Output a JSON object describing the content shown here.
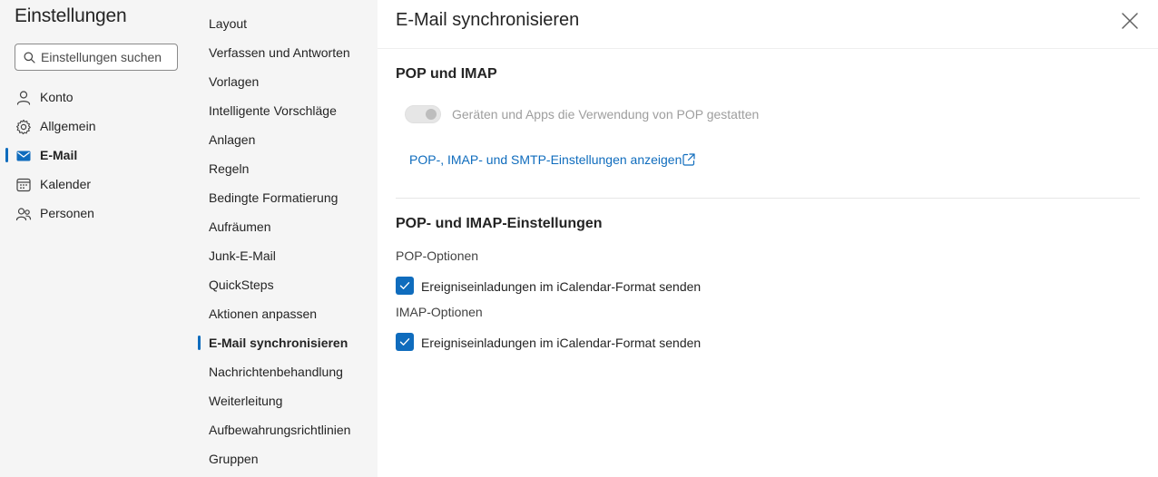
{
  "app": {
    "title": "Einstellungen"
  },
  "search": {
    "placeholder": "Einstellungen suchen",
    "value": ""
  },
  "categories": [
    {
      "label": "Konto",
      "icon": "person-icon"
    },
    {
      "label": "Allgemein",
      "icon": "gear-icon"
    },
    {
      "label": "E-Mail",
      "icon": "mail-icon",
      "active": true
    },
    {
      "label": "Kalender",
      "icon": "calendar-icon"
    },
    {
      "label": "Personen",
      "icon": "people-icon"
    }
  ],
  "submenu": [
    {
      "label": "Layout"
    },
    {
      "label": "Verfassen und Antworten"
    },
    {
      "label": "Vorlagen"
    },
    {
      "label": "Intelligente Vorschläge"
    },
    {
      "label": "Anlagen"
    },
    {
      "label": "Regeln"
    },
    {
      "label": "Bedingte Formatierung"
    },
    {
      "label": "Aufräumen"
    },
    {
      "label": "Junk-E-Mail"
    },
    {
      "label": "QuickSteps"
    },
    {
      "label": "Aktionen anpassen"
    },
    {
      "label": "E-Mail synchronisieren",
      "active": true
    },
    {
      "label": "Nachrichtenbehandlung"
    },
    {
      "label": "Weiterleitung"
    },
    {
      "label": "Aufbewahrungsrichtlinien"
    },
    {
      "label": "Gruppen"
    }
  ],
  "panel": {
    "title": "E-Mail synchronisieren",
    "close_icon": "close-icon",
    "pop_imap": {
      "title": "POP und IMAP",
      "toggle_label": "Geräten und Apps die Verwendung von POP gestatten",
      "toggle_on": false,
      "toggle_disabled": true,
      "link_label": "POP-, IMAP- und SMTP-Einstellungen anzeigen",
      "link_icon": "open-external-icon"
    },
    "settings": {
      "title": "POP- und IMAP-Einstellungen",
      "pop_label": "POP-Optionen",
      "pop_checkbox_label": "Ereigniseinladungen im iCalendar-Format senden",
      "pop_checked": true,
      "imap_label": "IMAP-Optionen",
      "imap_checkbox_label": "Ereigniseinladungen im iCalendar-Format senden",
      "imap_checked": true
    }
  },
  "colors": {
    "accent": "#0f6cbd",
    "sidebar_bg": "#f5f5f5",
    "text": "#242424",
    "disabled_text": "#9e9e9e"
  }
}
